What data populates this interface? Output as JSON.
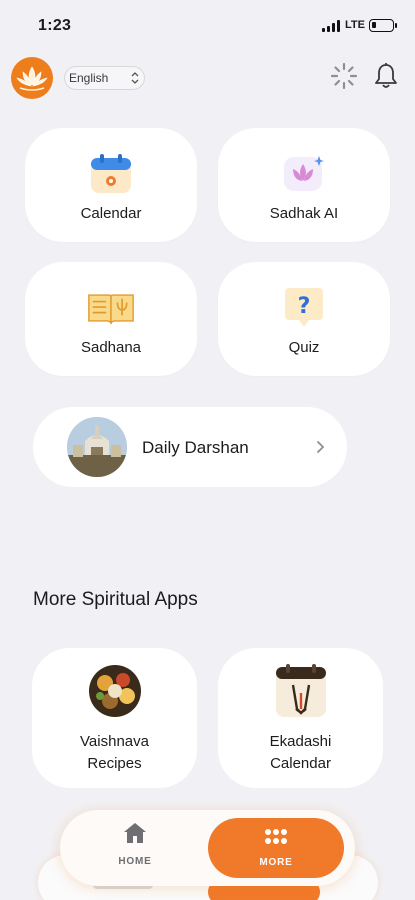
{
  "status_bar": {
    "time": "1:23",
    "network": "LTE"
  },
  "header": {
    "language": "English",
    "language_options": [
      "English"
    ],
    "icons": [
      "lotus-logo-icon",
      "gear-icon",
      "bell-icon"
    ]
  },
  "features": {
    "calendar": "Calendar",
    "sadhak_ai": "Sadhak AI",
    "sadhana": "Sadhana",
    "quiz": "Quiz",
    "darshan": "Daily Darshan"
  },
  "more_apps": {
    "title": "More Spiritual Apps",
    "vaishnava_line1": "Vaishnava",
    "vaishnava_line2": "Recipes",
    "ekadashi_line1": "Ekadashi",
    "ekadashi_line2": "Calendar"
  },
  "tabbar": {
    "home": "HOME",
    "more": "MORE",
    "active": "MORE"
  },
  "colors": {
    "accent": "#f07a2a",
    "background": "#f1f1f5",
    "card": "#ffffff"
  }
}
